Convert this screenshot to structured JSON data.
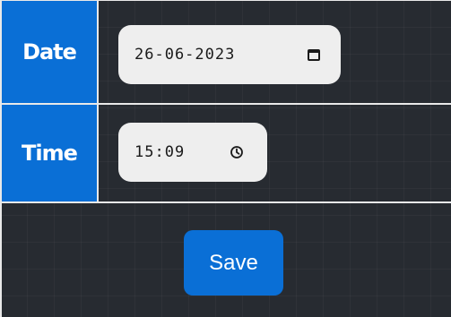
{
  "form": {
    "date": {
      "label": "Date",
      "value": "26-06-2023",
      "icon": "calendar-icon"
    },
    "time": {
      "label": "Time",
      "value": "15:09",
      "icon": "clock-icon"
    },
    "save_label": "Save"
  },
  "colors": {
    "accent": "#0a6fd6",
    "background": "#272b31",
    "input_background": "#eeeeee",
    "border": "#e9e9e9"
  }
}
